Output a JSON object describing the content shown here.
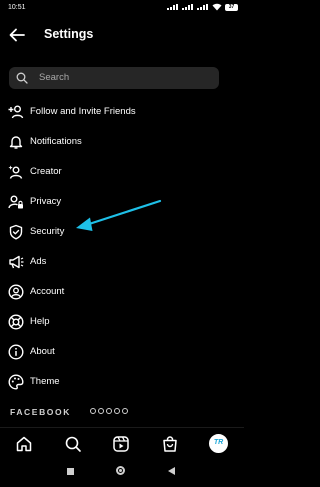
{
  "status": {
    "time": "10:51",
    "battery": "37"
  },
  "header": {
    "title": "Settings"
  },
  "search": {
    "placeholder": "Search"
  },
  "menu": {
    "items": [
      {
        "label": "Follow and Invite Friends",
        "icon": "add-person-icon"
      },
      {
        "label": "Notifications",
        "icon": "bell-icon"
      },
      {
        "label": "Creator",
        "icon": "creator-icon"
      },
      {
        "label": "Privacy",
        "icon": "lock-person-icon"
      },
      {
        "label": "Security",
        "icon": "shield-check-icon"
      },
      {
        "label": "Ads",
        "icon": "megaphone-icon"
      },
      {
        "label": "Account",
        "icon": "account-circle-icon"
      },
      {
        "label": "Help",
        "icon": "lifebuoy-icon"
      },
      {
        "label": "About",
        "icon": "info-icon"
      },
      {
        "label": "Theme",
        "icon": "palette-icon"
      }
    ]
  },
  "footer": {
    "brand": "FACEBOOK"
  },
  "bottom_nav": {
    "items": [
      "home-icon",
      "search-icon",
      "reels-icon",
      "shop-icon",
      "profile-avatar"
    ],
    "avatar_text": "TR"
  },
  "annotation": {
    "arrow_color": "#1ec0e8"
  }
}
